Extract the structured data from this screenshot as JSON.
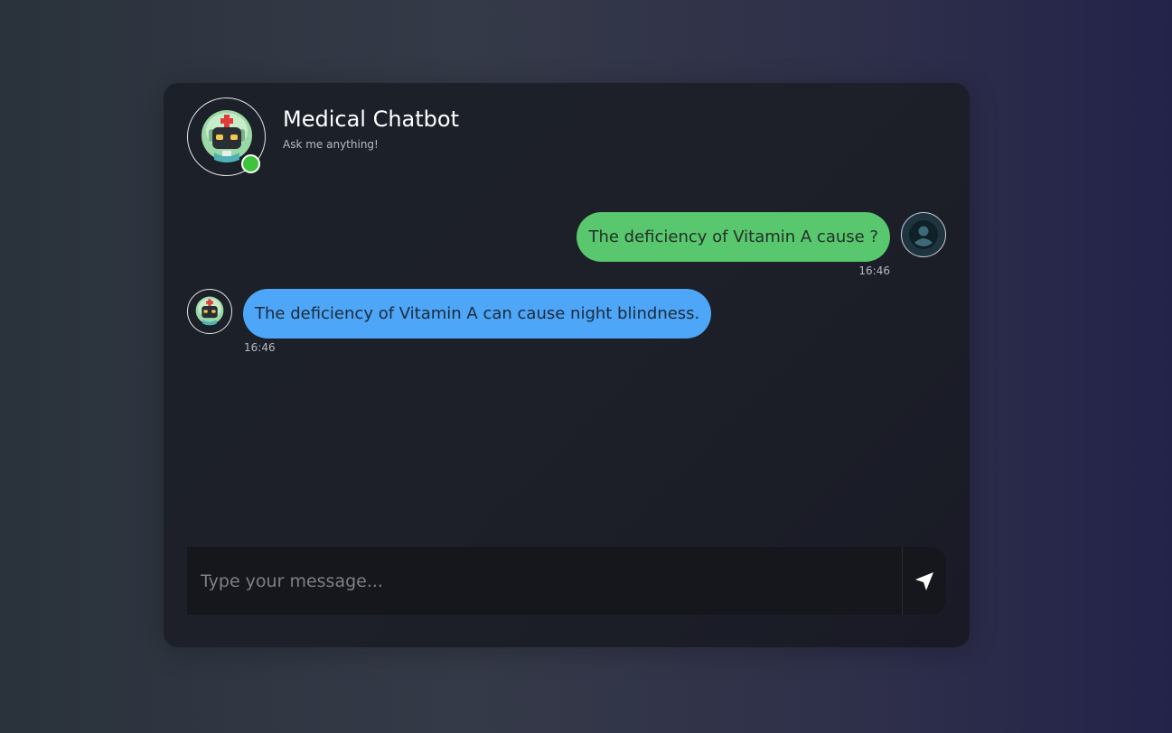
{
  "header": {
    "title": "Medical Chatbot",
    "subtitle": "Ask me anything!",
    "status": "online",
    "status_color": "#3ec43a"
  },
  "messages": [
    {
      "sender": "user",
      "text": "The deficiency of Vitamin A cause ?",
      "time": "16:46",
      "bubble_color": "#58c76d"
    },
    {
      "sender": "bot",
      "text": "The deficiency of Vitamin A can cause night blindness.",
      "time": "16:46",
      "bubble_color": "#4da6f7"
    }
  ],
  "composer": {
    "placeholder": "Type your message...",
    "value": "",
    "send_icon": "send-icon"
  },
  "icons": {
    "bot_avatar": "robot-doctor-icon",
    "user_avatar": "user-icon"
  }
}
